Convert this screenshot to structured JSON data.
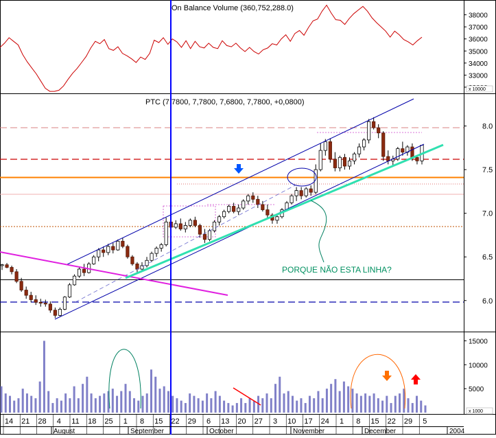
{
  "chart_data": [
    {
      "panel": "on-balance-volume",
      "type": "line",
      "title": "On Balance Volume (360,752,288.0)",
      "unit_label": "x 10000",
      "y_ticks": [
        32000,
        33000,
        34000,
        35000,
        36000,
        37000,
        38000
      ],
      "y_tick_labels": [
        "32000",
        "33000",
        "34000",
        "35000",
        "36000",
        "37000",
        "38000"
      ],
      "ylim": [
        31600,
        39000
      ],
      "series": [
        {
          "color": "#cc0000",
          "values": [
            35300,
            35650,
            36100,
            35800,
            35500,
            34700,
            34100,
            33600,
            33100,
            32500,
            31900,
            31650,
            31650,
            31750,
            32100,
            32650,
            33150,
            33550,
            34050,
            34550,
            35250,
            35800,
            35600,
            35950,
            35200,
            35050,
            35350,
            34800,
            34600,
            34350,
            34050,
            34500,
            34300,
            34800,
            35900,
            35700,
            36100,
            35550,
            36000,
            35750,
            35300,
            35850,
            35200,
            35800,
            35350,
            35250,
            35650,
            35300,
            35200,
            35850,
            35450,
            35350,
            35650,
            35250,
            34950,
            35300,
            34950,
            34750,
            35100,
            35250,
            35600,
            35500,
            36000,
            36350,
            35800,
            36450,
            36700,
            36300,
            36950,
            37500,
            37650,
            38300,
            38800,
            38150,
            37600,
            37550,
            37200,
            37700,
            38100,
            38400,
            38700,
            38300,
            37750,
            37350,
            37000,
            36650,
            36150,
            36650,
            36350,
            35950,
            35750,
            35500,
            35850,
            36150
          ]
        }
      ]
    },
    {
      "panel": "price",
      "type": "candlestick",
      "title": "PTC (7,7800, 7,7800, 7,6800, 7,7800, +0,0800)",
      "y_ticks": [
        6.0,
        6.5,
        7.0,
        7.5,
        8.0
      ],
      "y_tick_labels": [
        "6.0",
        "6.5",
        "7.0",
        "7.5",
        "8.0"
      ],
      "ylim": [
        5.66,
        8.35
      ],
      "candles": [
        [
          6.4,
          6.42,
          6.35,
          6.41
        ],
        [
          6.41,
          6.43,
          6.37,
          6.38
        ],
        [
          6.38,
          6.4,
          6.3,
          6.33
        ],
        [
          6.33,
          6.36,
          6.2,
          6.22
        ],
        [
          6.22,
          6.26,
          6.1,
          6.12
        ],
        [
          6.12,
          6.16,
          6.02,
          6.06
        ],
        [
          6.06,
          6.1,
          5.98,
          6.01
        ],
        [
          6.01,
          6.06,
          5.95,
          5.98
        ],
        [
          5.98,
          6.02,
          5.93,
          5.97
        ],
        [
          5.97,
          6.01,
          5.93,
          5.96
        ],
        [
          5.96,
          5.99,
          5.86,
          5.89
        ],
        [
          5.89,
          5.92,
          5.8,
          5.83
        ],
        [
          5.83,
          5.92,
          5.82,
          5.9
        ],
        [
          5.9,
          6.05,
          5.89,
          6.04
        ],
        [
          6.04,
          6.2,
          6.03,
          6.18
        ],
        [
          6.18,
          6.3,
          6.17,
          6.28
        ],
        [
          6.28,
          6.38,
          6.26,
          6.36
        ],
        [
          6.36,
          6.42,
          6.28,
          6.32
        ],
        [
          6.32,
          6.44,
          6.31,
          6.42
        ],
        [
          6.42,
          6.52,
          6.41,
          6.5
        ],
        [
          6.5,
          6.6,
          6.45,
          6.58
        ],
        [
          6.58,
          6.62,
          6.5,
          6.55
        ],
        [
          6.55,
          6.65,
          6.52,
          6.62
        ],
        [
          6.62,
          6.66,
          6.54,
          6.58
        ],
        [
          6.58,
          6.7,
          6.57,
          6.68
        ],
        [
          6.68,
          6.72,
          6.6,
          6.62
        ],
        [
          6.62,
          6.64,
          6.48,
          6.5
        ],
        [
          6.5,
          6.52,
          6.4,
          6.42
        ],
        [
          6.42,
          6.44,
          6.32,
          6.36
        ],
        [
          6.36,
          6.44,
          6.34,
          6.4
        ],
        [
          6.4,
          6.5,
          6.38,
          6.46
        ],
        [
          6.46,
          6.56,
          6.44,
          6.54
        ],
        [
          6.54,
          6.62,
          6.5,
          6.6
        ],
        [
          6.6,
          6.66,
          6.56,
          6.64
        ],
        [
          6.64,
          6.95,
          6.62,
          6.9
        ],
        [
          6.9,
          6.92,
          6.78,
          6.84
        ],
        [
          6.84,
          6.92,
          6.82,
          6.88
        ],
        [
          6.88,
          6.94,
          6.8,
          6.82
        ],
        [
          6.82,
          6.9,
          6.78,
          6.86
        ],
        [
          6.86,
          6.94,
          6.84,
          6.92
        ],
        [
          6.92,
          6.96,
          6.84,
          6.86
        ],
        [
          6.86,
          6.88,
          6.72,
          6.76
        ],
        [
          6.76,
          6.82,
          6.66,
          6.7
        ],
        [
          6.7,
          6.82,
          6.68,
          6.8
        ],
        [
          6.8,
          6.92,
          6.78,
          6.9
        ],
        [
          6.9,
          6.98,
          6.86,
          6.96
        ],
        [
          6.96,
          7.04,
          6.94,
          7.02
        ],
        [
          7.02,
          7.1,
          7.0,
          7.08
        ],
        [
          7.08,
          7.12,
          7.0,
          7.02
        ],
        [
          7.02,
          7.1,
          6.98,
          7.06
        ],
        [
          7.06,
          7.16,
          7.04,
          7.14
        ],
        [
          7.14,
          7.22,
          7.1,
          7.2
        ],
        [
          7.2,
          7.24,
          7.12,
          7.16
        ],
        [
          7.16,
          7.2,
          7.06,
          7.1
        ],
        [
          7.1,
          7.14,
          7.02,
          7.04
        ],
        [
          7.04,
          7.1,
          6.94,
          6.98
        ],
        [
          6.98,
          7.0,
          6.88,
          6.92
        ],
        [
          6.92,
          6.98,
          6.88,
          6.96
        ],
        [
          6.96,
          7.06,
          6.94,
          7.04
        ],
        [
          7.04,
          7.14,
          7.02,
          7.12
        ],
        [
          7.12,
          7.22,
          7.1,
          7.2
        ],
        [
          7.2,
          7.3,
          7.14,
          7.26
        ],
        [
          7.26,
          7.3,
          7.16,
          7.2
        ],
        [
          7.2,
          7.3,
          7.18,
          7.28
        ],
        [
          7.28,
          7.32,
          7.2,
          7.24
        ],
        [
          7.24,
          7.56,
          7.22,
          7.5
        ],
        [
          7.5,
          7.8,
          7.48,
          7.72
        ],
        [
          7.72,
          7.85,
          7.66,
          7.82
        ],
        [
          7.82,
          7.86,
          7.58,
          7.62
        ],
        [
          7.62,
          7.7,
          7.48,
          7.52
        ],
        [
          7.52,
          7.66,
          7.48,
          7.64
        ],
        [
          7.64,
          7.68,
          7.5,
          7.54
        ],
        [
          7.54,
          7.64,
          7.5,
          7.6
        ],
        [
          7.6,
          7.7,
          7.56,
          7.68
        ],
        [
          7.68,
          7.8,
          7.64,
          7.76
        ],
        [
          7.76,
          7.86,
          7.72,
          7.84
        ],
        [
          7.84,
          8.08,
          7.8,
          8.05
        ],
        [
          8.05,
          8.1,
          7.96,
          7.98
        ],
        [
          7.98,
          8.02,
          7.86,
          7.92
        ],
        [
          7.92,
          7.94,
          7.6,
          7.65
        ],
        [
          7.65,
          7.72,
          7.56,
          7.6
        ],
        [
          7.6,
          7.66,
          7.54,
          7.62
        ],
        [
          7.62,
          7.76,
          7.6,
          7.74
        ],
        [
          7.74,
          7.82,
          7.66,
          7.7
        ],
        [
          7.7,
          7.78,
          7.66,
          7.76
        ],
        [
          7.76,
          7.8,
          7.6,
          7.64
        ],
        [
          7.64,
          7.66,
          7.56,
          7.6
        ],
        [
          7.6,
          7.78,
          7.56,
          7.78
        ]
      ],
      "annotation": "PORQUE NÃO ESTA LINHA?"
    },
    {
      "panel": "volume",
      "type": "bar",
      "unit_label": "x 1000",
      "y_ticks": [
        5000,
        10000,
        15000
      ],
      "y_tick_labels": [
        "5000",
        "10000",
        "15000"
      ],
      "ylim": [
        0,
        16500
      ],
      "values": [
        5500,
        4000,
        3500,
        2500,
        3000,
        5000,
        4000,
        3500,
        3000,
        6500,
        15000,
        4500,
        2000,
        3000,
        2500,
        4000,
        3000,
        5500,
        3000,
        6000,
        7500,
        4000,
        3000,
        3500,
        4000,
        4500,
        5000,
        3500,
        4500,
        6000,
        4500,
        3000,
        2500,
        3500,
        4000,
        9000,
        7500,
        5000,
        5500,
        4500,
        3500,
        3000,
        2500,
        2000,
        4000,
        3500,
        3000,
        2500,
        4000,
        3000,
        4500,
        3500,
        2500,
        2000,
        1500,
        2000,
        3000,
        2000,
        3000,
        2500,
        3500,
        3000,
        4000,
        3000,
        6000,
        7500,
        4000,
        4500,
        3500,
        2500,
        3000,
        2000,
        3500,
        3000,
        4500,
        3000,
        5000,
        6000,
        7000,
        4500,
        6500,
        5500,
        5000,
        4000,
        3500,
        4000,
        3500,
        4000,
        3000,
        2500,
        3500,
        2000,
        3500,
        4000,
        5000,
        3000,
        2000,
        3500,
        2500,
        1500
      ]
    }
  ],
  "x_axis": {
    "day_labels": [
      "14",
      "21",
      "28",
      "4",
      "11",
      "18",
      "25",
      "1",
      "8",
      "15",
      "22",
      "29",
      "6",
      "13",
      "20",
      "27",
      "3",
      "10",
      "17",
      "24",
      "1",
      "8",
      "15",
      "22",
      "29",
      "5"
    ],
    "month_labels": [
      "August",
      "September",
      "October",
      "November",
      "December",
      "2004"
    ]
  }
}
